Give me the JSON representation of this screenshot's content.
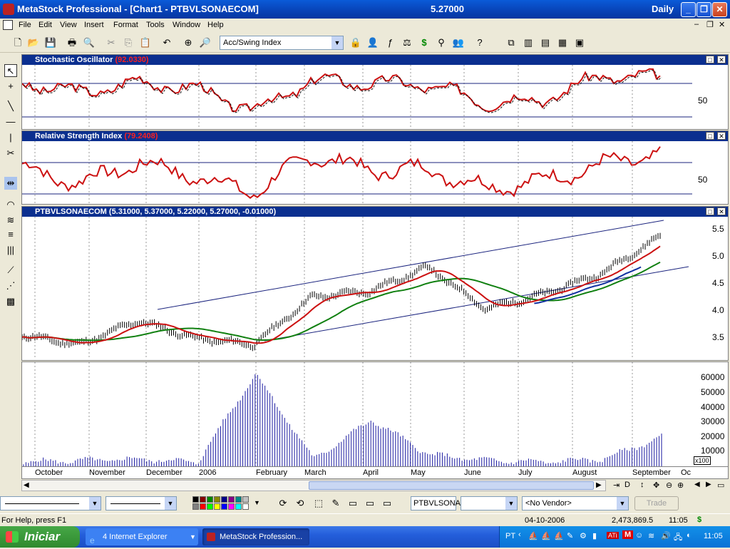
{
  "window": {
    "app_title": "MetaStock Professional - [Chart1 - PTBVLSONAECOM]",
    "last_price": "5.27000",
    "periodicity": "Daily",
    "minimize": "_",
    "maximize": "❐",
    "close": "✕"
  },
  "menu": [
    "File",
    "Edit",
    "View",
    "Insert",
    "Format",
    "Tools",
    "Window",
    "Help"
  ],
  "toolbar": {
    "indicator_select": "Acc/Swing Index",
    "icons": [
      "new-icon",
      "open-icon",
      "save-icon",
      "print-icon",
      "print-preview-icon",
      "cut-icon",
      "copy-icon",
      "paste-icon",
      "undo-icon",
      "crosshair-icon",
      "zoom-icon"
    ]
  },
  "panels": {
    "stochastic": {
      "name": "Stochastic Oscillator",
      "value": "(92.0330)",
      "y_label": "50"
    },
    "rsi": {
      "name": "Relative Strength Index",
      "value": "(79.2408)",
      "y_label": "50"
    },
    "price": {
      "name": "PTBVLSONAECOM",
      "values": "(5.31000, 5.37000, 5.22000, 5.27000, -0.01000)",
      "y_labels": [
        "5.5",
        "5.0",
        "4.5",
        "4.0",
        "3.5"
      ]
    },
    "volume": {
      "y_labels": [
        "60000",
        "50000",
        "40000",
        "30000",
        "20000",
        "10000"
      ],
      "multiplier": "x100"
    }
  },
  "x_axis": [
    "October",
    "November",
    "December",
    "2006",
    "February",
    "March",
    "April",
    "May",
    "June",
    "July",
    "August",
    "September",
    "Oc"
  ],
  "chart_data": {
    "type": "line",
    "symbol": "PTBVLSONAECOM",
    "x": [
      "October",
      "November",
      "December",
      "2006",
      "February",
      "March",
      "April",
      "May",
      "June",
      "July",
      "August",
      "September"
    ],
    "series": [
      {
        "name": "Stochastic Oscillator",
        "values": [
          77,
          62,
          78,
          68,
          35,
          80,
          77,
          74,
          47,
          52,
          88,
          84
        ]
      },
      {
        "name": "Relative Strength Index",
        "values": [
          66,
          52,
          71,
          58,
          44,
          78,
          64,
          65,
          48,
          55,
          69,
          79
        ]
      },
      {
        "name": "PTBVLSONAECOM",
        "values": [
          3.6,
          3.45,
          3.85,
          3.55,
          3.45,
          4.25,
          4.35,
          4.75,
          4.05,
          4.3,
          4.65,
          5.27
        ]
      },
      {
        "name": "Volume (x100)",
        "values": [
          3000,
          4000,
          5000,
          3000,
          64000,
          5000,
          32000,
          8000,
          4000,
          3000,
          5000,
          20000
        ]
      }
    ],
    "ylim_price": [
      3.2,
      5.6
    ],
    "ylim_volume": [
      0,
      65000
    ],
    "last_values": {
      "open": 5.31,
      "high": 5.37,
      "low": 5.22,
      "close": 5.27,
      "change": -0.01
    }
  },
  "bottom": {
    "security_field": "PTBVLSONA",
    "vendor_select": "<No Vendor>",
    "trade_button": "Trade"
  },
  "status": {
    "help": "For Help, press F1",
    "date": "04-10-2006",
    "volume": "2,473,869.5",
    "time": "11:05",
    "currency": "$"
  },
  "taskbar": {
    "start": "Iniciar",
    "tasks": [
      "4 Internet Explorer",
      "MetaStock Profession..."
    ],
    "lang": "PT",
    "clock": "11:05"
  }
}
